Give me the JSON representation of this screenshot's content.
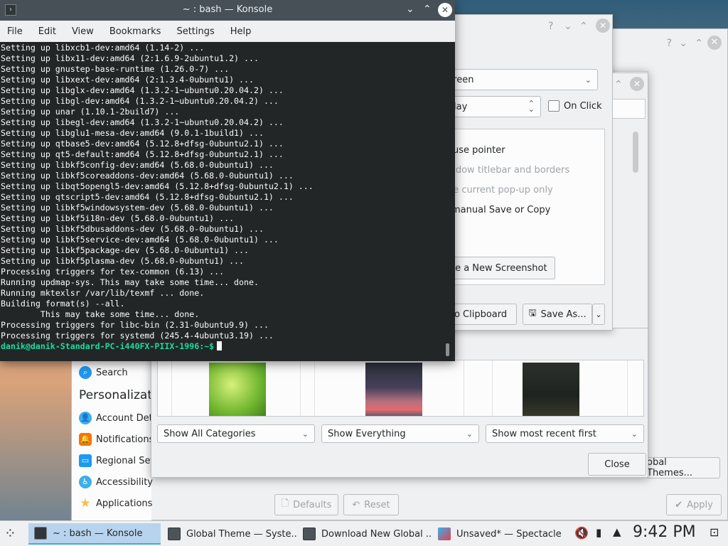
{
  "konsole": {
    "title": "~ : bash — Konsole",
    "menu": [
      "File",
      "Edit",
      "View",
      "Bookmarks",
      "Settings",
      "Help"
    ],
    "lines": [
      "Setting up libxcb1-dev:amd64 (1.14-2) ...",
      "Setting up libx11-dev:amd64 (2:1.6.9-2ubuntu1.2) ...",
      "Setting up gnustep-base-runtime (1.26.0-7) ...",
      "Setting up libxext-dev:amd64 (2:1.3.4-0ubuntu1) ...",
      "Setting up libglx-dev:amd64 (1.3.2-1~ubuntu0.20.04.2) ...",
      "Setting up libgl-dev:amd64 (1.3.2-1~ubuntu0.20.04.2) ...",
      "Setting up unar (1.10.1-2build7) ...",
      "Setting up libegl-dev:amd64 (1.3.2-1~ubuntu0.20.04.2) ...",
      "Setting up libglu1-mesa-dev:amd64 (9.0.1-1build1) ...",
      "Setting up qtbase5-dev:amd64 (5.12.8+dfsg-0ubuntu2.1) ...",
      "Setting up qt5-default:amd64 (5.12.8+dfsg-0ubuntu2.1) ...",
      "Setting up libkf5config-dev:amd64 (5.68.0-0ubuntu1) ...",
      "Setting up libkf5coreaddons-dev:amd64 (5.68.0-0ubuntu1) ...",
      "Setting up libqt5opengl5-dev:amd64 (5.12.8+dfsg-0ubuntu2.1) ...",
      "Setting up qtscript5-dev:amd64 (5.12.8+dfsg-0ubuntu2.1) ...",
      "Setting up libkf5windowsystem-dev (5.68.0-0ubuntu1) ...",
      "Setting up libkf5i18n-dev (5.68.0-0ubuntu1) ...",
      "Setting up libkf5dbusaddons-dev (5.68.0-0ubuntu1) ...",
      "Setting up libkf5service-dev:amd64 (5.68.0-0ubuntu1) ...",
      "Setting up libkf5package-dev (5.68.0-0ubuntu1) ...",
      "Setting up libkf5plasma-dev (5.68.0-0ubuntu1) ...",
      "Processing triggers for tex-common (6.13) ...",
      "Running updmap-sys. This may take some time... done.",
      "Running mktexlsr /var/lib/texmf ... done.",
      "Building format(s) --all.",
      "        This may take some time... done.",
      "Processing triggers for libc-bin (2.31-0ubuntu9.9) ...",
      "Processing triggers for systemd (245.4-4ubuntu3.19) ..."
    ],
    "prompt": "danik@danik-Standard-PC-i440FX-PIIX-1996:~$"
  },
  "spectacle": {
    "area_value": "creen",
    "delay_value": "elay",
    "on_click": "On Click",
    "options": [
      "ouse pointer",
      "indow titlebar and borders",
      "he current pop-up only",
      "manual Save or Copy"
    ],
    "new_screenshot": "ke a New Screenshot",
    "to_clipboard": "to Clipboard",
    "save_as": "Save As..."
  },
  "ghns": {
    "filter_categories": "Show All Categories",
    "filter_everything": "Show Everything",
    "sort": "Show most recent first",
    "close": "Close"
  },
  "system_settings": {
    "search": "Search",
    "section": "Personalizatio",
    "items": [
      {
        "label": "Account Deta",
        "icon": "account-icon",
        "color": "#3daee9"
      },
      {
        "label": "Notifications",
        "icon": "bell-icon",
        "color": "#f67400"
      },
      {
        "label": "Regional Set",
        "icon": "chat-icon",
        "color": "#1d99f3"
      },
      {
        "label": "Accessibility",
        "icon": "accessibility-icon",
        "color": "#3daee9"
      },
      {
        "label": "Applications",
        "icon": "star-icon",
        "color": "#fdbc4b"
      }
    ],
    "defaults": "Defaults",
    "reset": "Reset",
    "apply": "Apply",
    "global_themes": "obal Themes..."
  },
  "taskbar": {
    "tasks": [
      {
        "label": "~ : bash — Konsole",
        "icon": "konsole-icon",
        "active": true
      },
      {
        "label": "Global Theme — Syste...",
        "icon": "settings-window-icon",
        "active": false
      },
      {
        "label": "Download New Global ...",
        "icon": "download-window-icon",
        "active": false
      },
      {
        "label": "Unsaved* — Spectacle",
        "icon": "spectacle-icon",
        "active": false
      }
    ],
    "clock": "9:42 PM"
  }
}
